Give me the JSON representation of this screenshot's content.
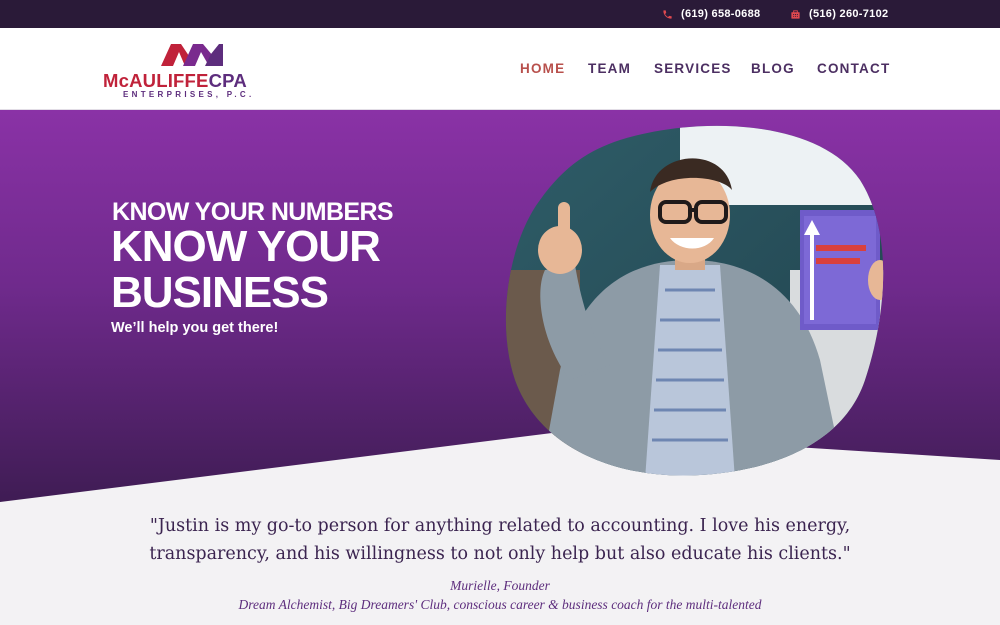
{
  "topbar": {
    "phone_1": "(619) 658-0688",
    "phone_2": "(516) 260-7102",
    "phone_icon": "phone-icon",
    "fax_icon": "fax-icon",
    "icon_color": "#e0494f"
  },
  "logo": {
    "name_red": "McAULIFFE",
    "name_purple": "CPA",
    "subtitle": "ENTERPRISES, P.C."
  },
  "nav": {
    "items": [
      {
        "label": "HOME",
        "active": true
      },
      {
        "label": "TEAM",
        "active": false
      },
      {
        "label": "SERVICES",
        "active": false
      },
      {
        "label": "BLOG",
        "active": false
      },
      {
        "label": "CONTACT",
        "active": false
      }
    ]
  },
  "hero": {
    "heading_small": "KNOW YOUR NUMBERS",
    "heading_big_line1": "KNOW YOUR",
    "heading_big_line2": "BUSINESS",
    "tagline": "We’ll help you get there!"
  },
  "testimonial": {
    "quote": "\"Justin is my go-to person for anything related to accounting. I love his energy, transparency, and his willingness to not only help but also educate his clients.\"",
    "author": "Murielle, Founder",
    "author_detail": "Dream Alchemist, Big Dreamers' Club, conscious career & business coach for the multi-talented"
  },
  "colors": {
    "brand_red": "#c0223a",
    "brand_purple": "#5d2d7d",
    "nav_active": "#b8504c",
    "hero_top": "#8a32a6",
    "hero_bottom": "#3f1c54"
  }
}
